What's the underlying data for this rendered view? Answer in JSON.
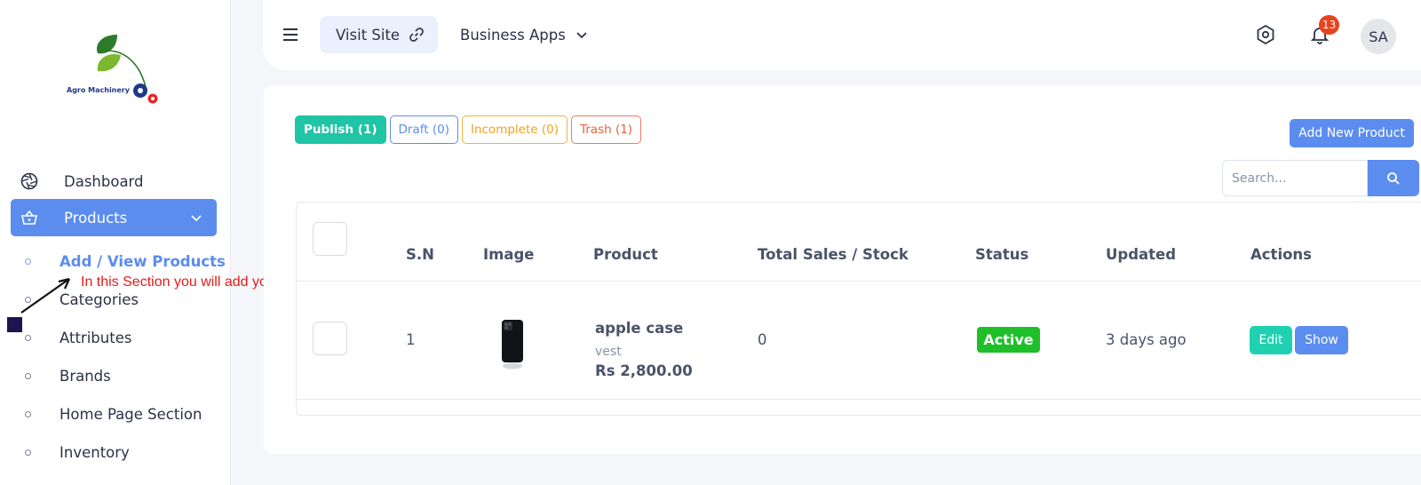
{
  "brand": {
    "logo_text": "Agro Machinery"
  },
  "sidebar": {
    "items": [
      {
        "label": "Dashboard",
        "icon": "aperture-icon"
      },
      {
        "label": "Products",
        "icon": "basket-icon",
        "active": true
      }
    ],
    "sub_items": [
      {
        "label": "Add / View Products",
        "active": true
      },
      {
        "label": "Categories"
      },
      {
        "label": "Attributes"
      },
      {
        "label": "Brands"
      },
      {
        "label": "Home Page Section"
      },
      {
        "label": "Inventory"
      }
    ]
  },
  "annotation": {
    "text": "In this Section you will add your Product"
  },
  "topbar": {
    "visit_site": "Visit Site",
    "business_apps": "Business Apps",
    "notifications_count": "13",
    "avatar_initials": "SA"
  },
  "tabs": [
    {
      "label": "Publish (1)",
      "style": "publish"
    },
    {
      "label": "Draft (0)",
      "style": "draft"
    },
    {
      "label": "Incomplete (0)",
      "style": "incomplete"
    },
    {
      "label": "Trash (1)",
      "style": "trash"
    }
  ],
  "actions": {
    "add_new_product": "Add New Product"
  },
  "search": {
    "placeholder": "Search..."
  },
  "table": {
    "headers": [
      "S.N",
      "Image",
      "Product",
      "Total Sales / Stock",
      "Status",
      "Updated",
      "Actions"
    ],
    "rows": [
      {
        "sn": "1",
        "product_name": "apple case",
        "product_sub": "vest",
        "price": "Rs 2,800.00",
        "sales_stock": "0",
        "status": "Active",
        "updated": "3 days ago",
        "edit_label": "Edit",
        "show_label": "Show"
      }
    ]
  },
  "colors": {
    "primary": "#5b8def",
    "publish": "#1fc5a4",
    "draft": "#5b8def",
    "incomplete": "#f0a31c",
    "trash": "#e8603f",
    "status_active": "#1fbf2a",
    "badge": "#e8421e",
    "annotation": "#e41b1b"
  }
}
